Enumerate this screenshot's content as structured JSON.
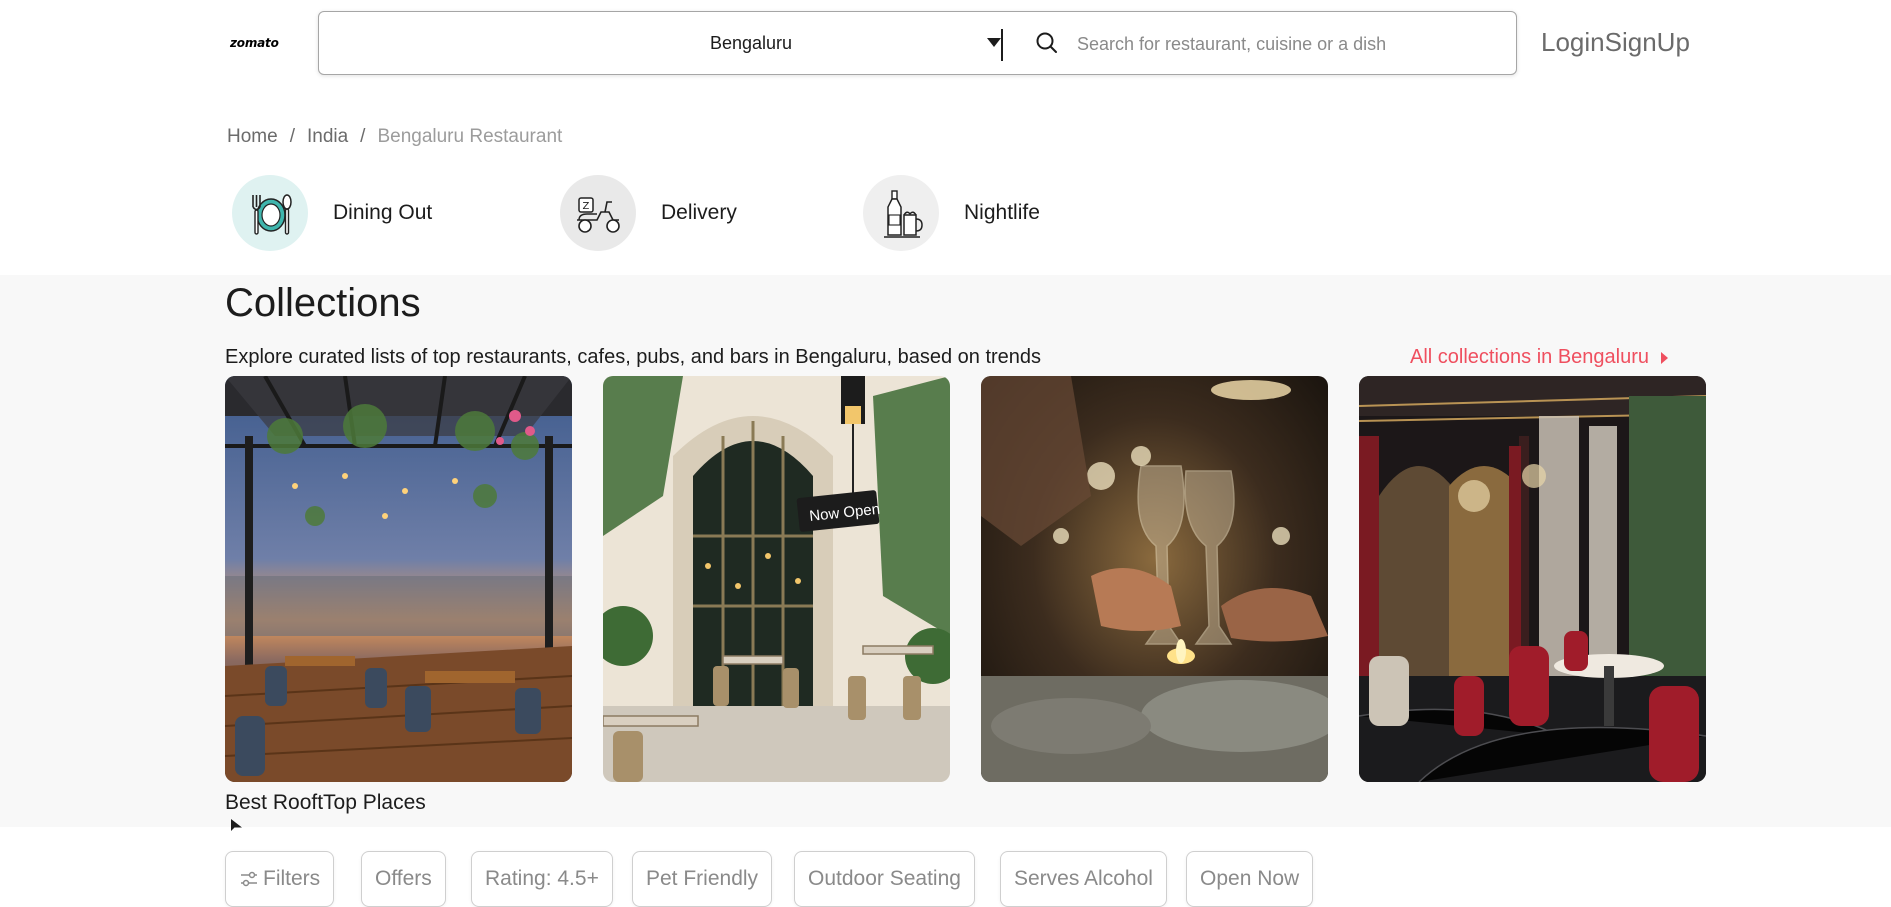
{
  "header": {
    "logo": "zomato",
    "location": "Bengaluru",
    "search_placeholder": "Search for restaurant, cuisine or a dish",
    "login": "Login",
    "signup": "SignUp"
  },
  "breadcrumb": {
    "items": [
      "Home",
      "India",
      "Bengaluru Restaurant"
    ],
    "separator": "/"
  },
  "tabs": [
    {
      "label": "Dining Out",
      "icon": "dining-out-icon"
    },
    {
      "label": "Delivery",
      "icon": "delivery-scooter-icon"
    },
    {
      "label": "Nightlife",
      "icon": "nightlife-drinks-icon"
    }
  ],
  "collections": {
    "title": "Collections",
    "subtitle": "Explore curated lists of top restaurants, cafes, pubs, and bars in Bengaluru, based on trends",
    "all_link": "All collections in Bengaluru",
    "cards": [
      {
        "caption": "Best RooftTop Places",
        "image": "rooftop-terrace-image"
      },
      {
        "caption": "",
        "image": "now-open-cafe-image",
        "sign": "Now Open"
      },
      {
        "caption": "",
        "image": "wine-toast-image"
      },
      {
        "caption": "",
        "image": "luxury-dining-hall-image"
      }
    ]
  },
  "filters": {
    "chips": [
      "Filters",
      "Offers",
      "Rating: 4.5+",
      "Pet Friendly",
      "Outdoor Seating",
      "Serves Alcohol",
      "Open Now"
    ]
  },
  "colors": {
    "brand_accent": "#ef4f5f",
    "collections_bg": "#f8f8f8"
  }
}
